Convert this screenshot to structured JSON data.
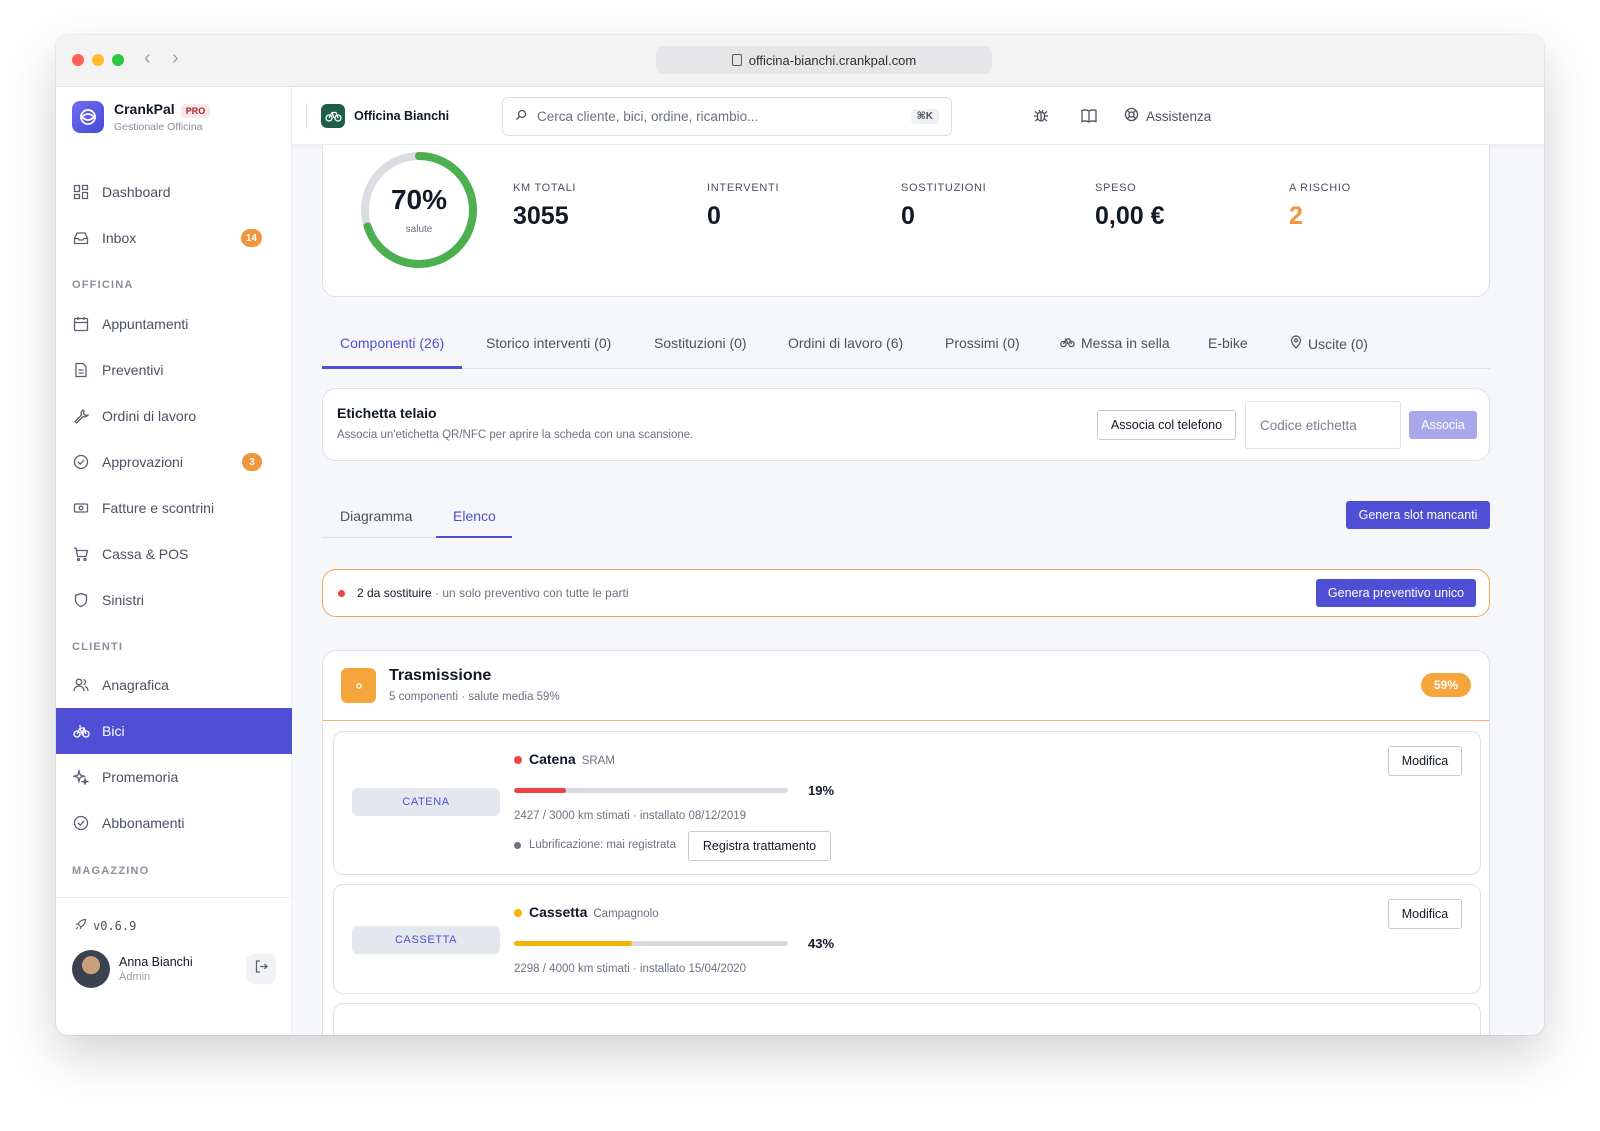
{
  "browser": {
    "url": "officina-bianchi.crankpal.com"
  },
  "brand": {
    "name": "CrankPal",
    "badge": "PRO",
    "subtitle": "Gestionale Officina"
  },
  "sidebar": {
    "items": [
      {
        "label": "Dashboard",
        "icon": "dashboard-icon"
      },
      {
        "label": "Inbox",
        "icon": "inbox-icon",
        "badge": "14"
      },
      {
        "label": "Appuntamenti",
        "icon": "calendar-icon"
      },
      {
        "label": "Preventivi",
        "icon": "document-icon"
      },
      {
        "label": "Ordini di lavoro",
        "icon": "wrench-icon"
      },
      {
        "label": "Approvazioni",
        "icon": "check-circle-icon",
        "badge": "3"
      },
      {
        "label": "Fatture e scontrini",
        "icon": "receipt-icon"
      },
      {
        "label": "Cassa & POS",
        "icon": "cart-icon"
      },
      {
        "label": "Sinistri",
        "icon": "shield-icon"
      },
      {
        "label": "Anagrafica",
        "icon": "users-icon"
      },
      {
        "label": "Bici",
        "icon": "bike-icon",
        "active": true
      },
      {
        "label": "Promemoria",
        "icon": "sparkles-icon"
      },
      {
        "label": "Abbonamenti",
        "icon": "check-circle-icon"
      }
    ],
    "sections": [
      "OFFICINA",
      "CLIENTI",
      "MAGAZZINO"
    ],
    "version": "v0.6.9",
    "user": {
      "name": "Anna Bianchi",
      "role": "Admin"
    }
  },
  "header": {
    "shop_name": "Officina Bianchi",
    "search_placeholder": "Cerca cliente, bici, ordine, ricambio...",
    "search_shortcut": "⌘K",
    "help_label": "Assistenza"
  },
  "stats": {
    "health_percent": 70,
    "health_text": "70%",
    "health_label": "salute",
    "items": [
      {
        "label": "KM TOTALI",
        "value": "3055"
      },
      {
        "label": "INTERVENTI",
        "value": "0"
      },
      {
        "label": "SOSTITUZIONI",
        "value": "0"
      },
      {
        "label": "SPESO",
        "value": "0,00 €"
      },
      {
        "label": "A RISCHIO",
        "value": "2"
      }
    ]
  },
  "tabs": [
    "Componenti (26)",
    "Storico interventi (0)",
    "Sostituzioni (0)",
    "Ordini di lavoro (6)",
    "Prossimi (0)",
    "Messa in sella",
    "E-bike",
    "Uscite (0)"
  ],
  "tag": {
    "title": "Etichetta telaio",
    "subtitle": "Associa un'etichetta QR/NFC per aprire la scheda con una scansione.",
    "phone_button": "Associa col telefono",
    "code_placeholder": "Codice etichetta",
    "associate_button": "Associa"
  },
  "view_tabs": [
    "Diagramma",
    "Elenco"
  ],
  "generate_slots_button": "Genera slot mancanti",
  "alert": {
    "strong": "2 da sostituire",
    "text": " · un solo preventivo con tutte le parti",
    "button": "Genera preventivo unico"
  },
  "group": {
    "title": "Trasmissione",
    "subtitle": "5 componenti · salute media 59%",
    "badge": "59%",
    "components": [
      {
        "chip": "CATENA",
        "name": "Catena",
        "brand": "SRAM",
        "health": 19,
        "health_text": "19%",
        "status_color": "#ef4444",
        "meta": "2427 / 3000 km stimati · installato 08/12/2019",
        "lube": "Lubrificazione: mai registrata",
        "lube_button": "Registra trattamento",
        "edit_button": "Modifica"
      },
      {
        "chip": "CASSETTA",
        "name": "Cassetta",
        "brand": "Campagnolo",
        "health": 43,
        "health_text": "43%",
        "status_color": "#f5b400",
        "meta": "2298 / 4000 km stimati · installato 15/04/2020",
        "edit_button": "Modifica"
      }
    ]
  },
  "colors": {
    "accent": "#4f4fd6",
    "warning": "#f0953b",
    "danger": "#ef4444",
    "success": "#4caf50"
  }
}
